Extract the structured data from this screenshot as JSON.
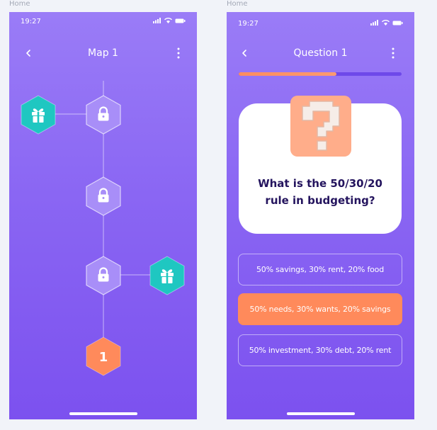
{
  "frames": [
    {
      "label": "Home"
    },
    {
      "label": "Home"
    }
  ],
  "map_screen": {
    "status_time": "19:27",
    "title": "Map 1",
    "nodes": [
      {
        "type": "gift",
        "icon": "gift-icon",
        "state": "reward"
      },
      {
        "type": "locked",
        "icon": "lock-icon",
        "state": "locked"
      },
      {
        "type": "locked",
        "icon": "lock-icon",
        "state": "locked"
      },
      {
        "type": "locked",
        "icon": "lock-icon",
        "state": "locked"
      },
      {
        "type": "gift",
        "icon": "gift-icon",
        "state": "reward"
      },
      {
        "type": "level",
        "label": "1",
        "state": "current"
      }
    ]
  },
  "quiz_screen": {
    "status_time": "19:27",
    "title": "Question 1",
    "progress": 0.6,
    "question_icon": "question-mark-icon",
    "question": "What is the 50/30/20 rule in budgeting?",
    "answers": [
      {
        "label": "50% savings, 30% rent, 20% food",
        "selected": false
      },
      {
        "label": "50% needs, 30% wants, 20% savings",
        "selected": true
      },
      {
        "label": "50% investment, 30% debt, 20% rent",
        "selected": false
      }
    ]
  },
  "colors": {
    "background_top": "#9a7cf7",
    "background_bottom": "#7c51ef",
    "gift_node": "#1fc7c1",
    "current_node": "#ff8a5b",
    "question_text": "#24145e",
    "selected_answer": "#ff8a5b"
  }
}
